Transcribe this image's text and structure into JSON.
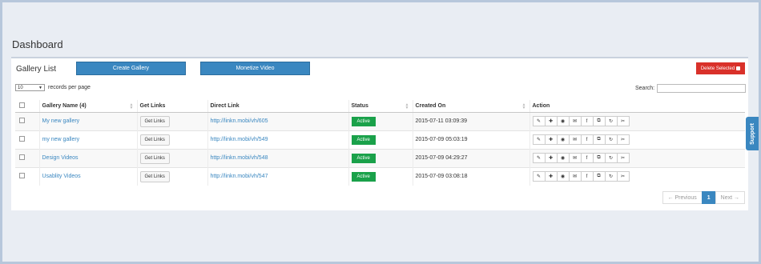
{
  "page": {
    "title": "Dashboard"
  },
  "panel": {
    "title": "Gallery List",
    "create_label": "Create Gallery",
    "monetize_label": "Monetize Video",
    "delete_label": "Delete Selected"
  },
  "controls": {
    "length_value": "10",
    "length_suffix": "records per page",
    "search_label": "Search:",
    "search_value": ""
  },
  "table": {
    "headers": [
      "Gallery Name (4)",
      "Get Links",
      "Direct Link",
      "Status",
      "Created On",
      "Action"
    ],
    "rows": [
      {
        "name": "My new gallery",
        "getlinks": "Get Links",
        "link": "http://linkn.mobi/vh/605",
        "status": "Active",
        "created": "2015-07-11 03:09:39"
      },
      {
        "name": "my new gallery",
        "getlinks": "Get Links",
        "link": "http://linkn.mobi/vh/549",
        "status": "Active",
        "created": "2015-07-09 05:03:19"
      },
      {
        "name": "Design Videos",
        "getlinks": "Get Links",
        "link": "http://linkn.mobi/vh/548",
        "status": "Active",
        "created": "2015-07-09 04:29:27"
      },
      {
        "name": "Usablity Videos",
        "getlinks": "Get Links",
        "link": "http://linkn.mobi/vh/547",
        "status": "Active",
        "created": "2015-07-09 03:08:18"
      }
    ],
    "action_icons": [
      "edit-icon",
      "add-icon",
      "view-icon",
      "email-icon",
      "facebook-icon",
      "copy-icon",
      "refresh-icon",
      "attach-icon"
    ]
  },
  "pagination": {
    "prev": "← Previous",
    "current": "1",
    "next": "Next →"
  },
  "support": {
    "label": "Support"
  },
  "colors": {
    "accent": "#3a87c0",
    "danger": "#d9312a",
    "success": "#1aa14a"
  }
}
